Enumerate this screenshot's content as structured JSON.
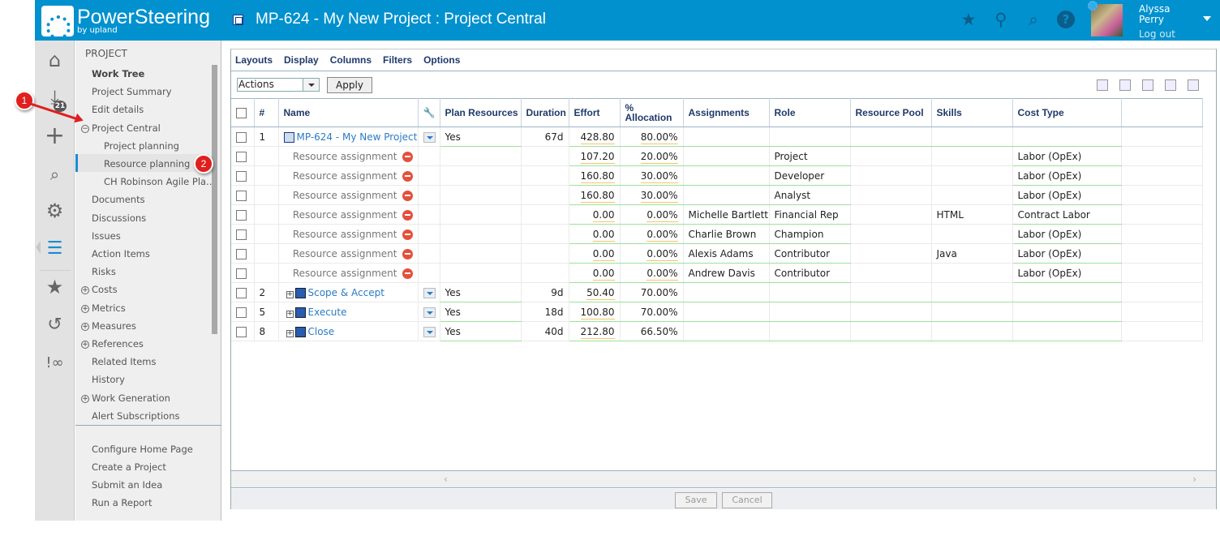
{
  "header": {
    "brand": "PowerSteering",
    "brand_sub": "by upland",
    "page_title": "MP-624 - My New Project : Project Central",
    "user_first": "Alyssa",
    "user_last": "Perry",
    "logout": "Log out",
    "icons": [
      "star-icon",
      "map-pin-icon",
      "search-icon",
      "help-icon"
    ]
  },
  "rail": {
    "badge": "21"
  },
  "sidenav": {
    "heading": "PROJECT",
    "items": [
      {
        "label": "Work Tree",
        "bold": true
      },
      {
        "label": "Project Summary"
      },
      {
        "label": "Edit details"
      },
      {
        "label": "Project Central",
        "expander": "⊖"
      },
      {
        "label": "Project planning",
        "sub": true
      },
      {
        "label": "Resource planning",
        "sub": true,
        "selected": true
      },
      {
        "label": "CH Robinson Agile Pla...",
        "sub": true
      },
      {
        "label": "Documents"
      },
      {
        "label": "Discussions"
      },
      {
        "label": "Issues"
      },
      {
        "label": "Action Items"
      },
      {
        "label": "Risks"
      },
      {
        "label": "Costs",
        "expander": "⊕"
      },
      {
        "label": "Metrics",
        "expander": "⊕"
      },
      {
        "label": "Measures",
        "expander": "⊕"
      },
      {
        "label": "References",
        "expander": "⊕"
      },
      {
        "label": "Related Items"
      },
      {
        "label": "History"
      },
      {
        "label": "Work Generation",
        "expander": "⊕"
      },
      {
        "label": "Alert Subscriptions"
      }
    ],
    "footer_items": [
      "Configure Home Page",
      "Create a Project",
      "Submit an Idea",
      "Run a Report"
    ]
  },
  "callouts": [
    "1",
    "2"
  ],
  "menubar": [
    "Layouts",
    "Display",
    "Columns",
    "Filters",
    "Options"
  ],
  "actions": {
    "select_value": "Actions",
    "apply": "Apply"
  },
  "grid": {
    "columns": [
      "#",
      "Name",
      "",
      "Plan Resources",
      "Duration",
      "Effort",
      "% Allocation",
      "Assignments",
      "Role",
      "Resource Pool",
      "Skills",
      "Cost Type"
    ],
    "rows": [
      {
        "num": "1",
        "name": "MP-624 - My New Project",
        "type": "project",
        "plan": "Yes",
        "duration": "67d",
        "effort": "428.80",
        "alloc": "80.00%",
        "assign": "",
        "role": "",
        "pool": "",
        "skills": "",
        "cost": ""
      },
      {
        "num": "",
        "name": "Resource assignment",
        "type": "assignment",
        "plan": "",
        "duration": "",
        "effort": "107.20",
        "alloc": "20.00%",
        "assign": "",
        "role": "Project",
        "pool": "",
        "skills": "",
        "cost": "Labor (OpEx)"
      },
      {
        "num": "",
        "name": "Resource assignment",
        "type": "assignment",
        "plan": "",
        "duration": "",
        "effort": "160.80",
        "alloc": "30.00%",
        "assign": "",
        "role": "Developer",
        "pool": "",
        "skills": "",
        "cost": "Labor (OpEx)"
      },
      {
        "num": "",
        "name": "Resource assignment",
        "type": "assignment",
        "plan": "",
        "duration": "",
        "effort": "160.80",
        "alloc": "30.00%",
        "assign": "",
        "role": "Analyst",
        "pool": "",
        "skills": "",
        "cost": "Labor (OpEx)"
      },
      {
        "num": "",
        "name": "Resource assignment",
        "type": "assignment",
        "plan": "",
        "duration": "",
        "effort": "0.00",
        "alloc": "0.00%",
        "assign": "Michelle Bartlett",
        "role": "Financial Rep",
        "pool": "",
        "skills": "HTML",
        "cost": "Contract Labor"
      },
      {
        "num": "",
        "name": "Resource assignment",
        "type": "assignment",
        "plan": "",
        "duration": "",
        "effort": "0.00",
        "alloc": "0.00%",
        "assign": "Charlie Brown",
        "role": "Champion",
        "pool": "",
        "skills": "",
        "cost": "Labor (OpEx)"
      },
      {
        "num": "",
        "name": "Resource assignment",
        "type": "assignment",
        "plan": "",
        "duration": "",
        "effort": "0.00",
        "alloc": "0.00%",
        "assign": "Alexis Adams",
        "role": "Contributor",
        "pool": "",
        "skills": "Java",
        "cost": "Labor (OpEx)"
      },
      {
        "num": "",
        "name": "Resource assignment",
        "type": "assignment",
        "plan": "",
        "duration": "",
        "effort": "0.00",
        "alloc": "0.00%",
        "assign": "Andrew Davis",
        "role": "Contributor",
        "pool": "",
        "skills": "",
        "cost": "Labor (OpEx)"
      },
      {
        "num": "2",
        "name": "Scope & Accept",
        "type": "task",
        "plan": "Yes",
        "duration": "9d",
        "effort": "50.40",
        "alloc": "70.00%",
        "assign": "",
        "role": "",
        "pool": "",
        "skills": "",
        "cost": ""
      },
      {
        "num": "5",
        "name": "Execute",
        "type": "task",
        "plan": "Yes",
        "duration": "18d",
        "effort": "100.80",
        "alloc": "70.00%",
        "assign": "",
        "role": "",
        "pool": "",
        "skills": "",
        "cost": ""
      },
      {
        "num": "8",
        "name": "Close",
        "type": "task",
        "plan": "Yes",
        "duration": "40d",
        "effort": "212.80",
        "alloc": "66.50%",
        "assign": "",
        "role": "",
        "pool": "",
        "skills": "",
        "cost": ""
      }
    ]
  },
  "footer": {
    "save": "Save",
    "cancel": "Cancel"
  }
}
